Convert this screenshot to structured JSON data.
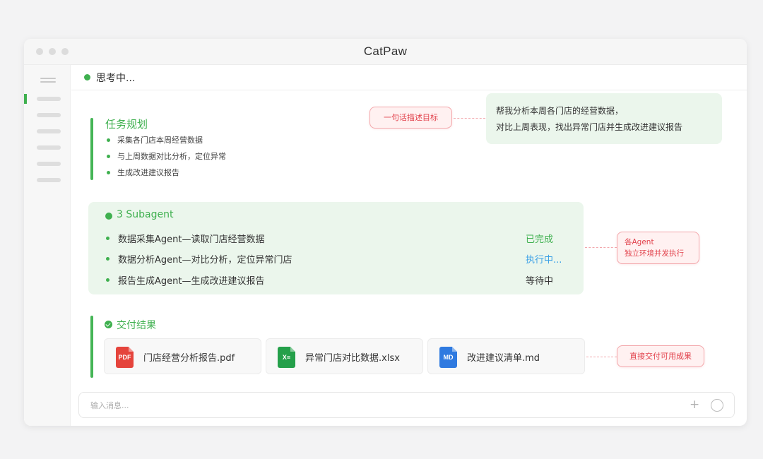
{
  "window": {
    "title": "CatPaw"
  },
  "status": {
    "text": "思考中..."
  },
  "plan": {
    "title": "任务规划",
    "items": [
      "采集各门店本周经营数据",
      "与上周数据对比分析，定位异常",
      "生成改进建议报告"
    ]
  },
  "goal": {
    "tag": "一句话描述目标",
    "message_line1": "帮我分析本周各门店的经营数据，",
    "message_line2": "对比上周表现，找出异常门店并生成改进建议报告"
  },
  "subagents": {
    "title": "3 Subagent",
    "rows": [
      {
        "name": "数据采集Agent—读取门店经营数据",
        "state": "已完成",
        "state_color": "#3fb04f"
      },
      {
        "name": "数据分析Agent—对比分析，定位异常门店",
        "state": "执行中...",
        "state_color": "#3aa0e6"
      },
      {
        "name": "报告生成Agent—生成改进建议报告",
        "state": "等待中",
        "state_color": "#333333"
      }
    ],
    "tag_line1": "各Agent",
    "tag_line2": "独立环境并发执行"
  },
  "deliverables": {
    "title": "交付结果",
    "files": [
      {
        "icon_label": "PDF",
        "icon": "pdf-file-icon",
        "color": "#e5443c",
        "name": "门店经营分析报告.pdf"
      },
      {
        "icon_label": "X≡",
        "icon": "excel-file-icon",
        "color": "#24a04a",
        "name": "异常门店对比数据.xlsx"
      },
      {
        "icon_label": "MD",
        "icon": "markdown-file-icon",
        "color": "#2f7ae0",
        "name": "改进建议清单.md"
      }
    ],
    "tag": "直接交付可用成果"
  },
  "composer": {
    "placeholder": "输入消息...",
    "value": "",
    "plus_label": "+"
  },
  "colors": {
    "accent": "#3fb04f",
    "annotation": "#e2434d",
    "running": "#3aa0e6"
  }
}
